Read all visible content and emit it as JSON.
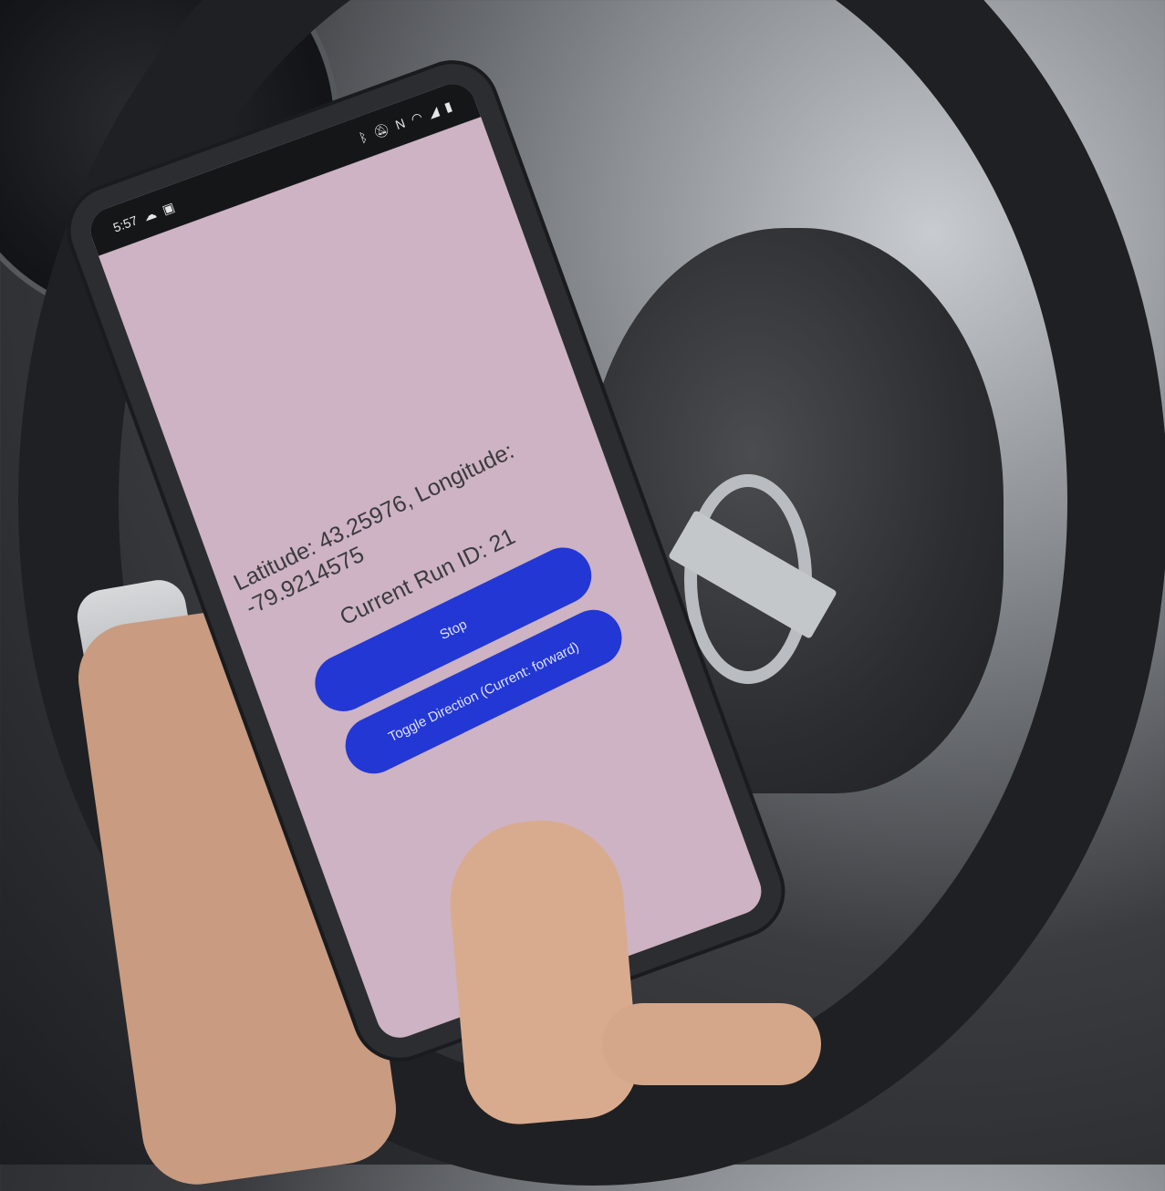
{
  "status_bar": {
    "time": "5:57",
    "left_icons": [
      "cloud-icon",
      "notification-icon"
    ],
    "right_icons": [
      "bluetooth-icon",
      "mute-icon",
      "nfc-icon",
      "wifi-icon",
      "signal-icon",
      "battery-icon"
    ]
  },
  "app": {
    "location_text": "Latitude: 43.25976, Longitude: -79.9214575",
    "run_id_text": "Current Run ID: 21",
    "stop_label": "Stop",
    "toggle_label": "Toggle Direction (Current: forward)"
  },
  "colors": {
    "screen_bg": "#cdb3c3",
    "button": "#2337d4"
  }
}
